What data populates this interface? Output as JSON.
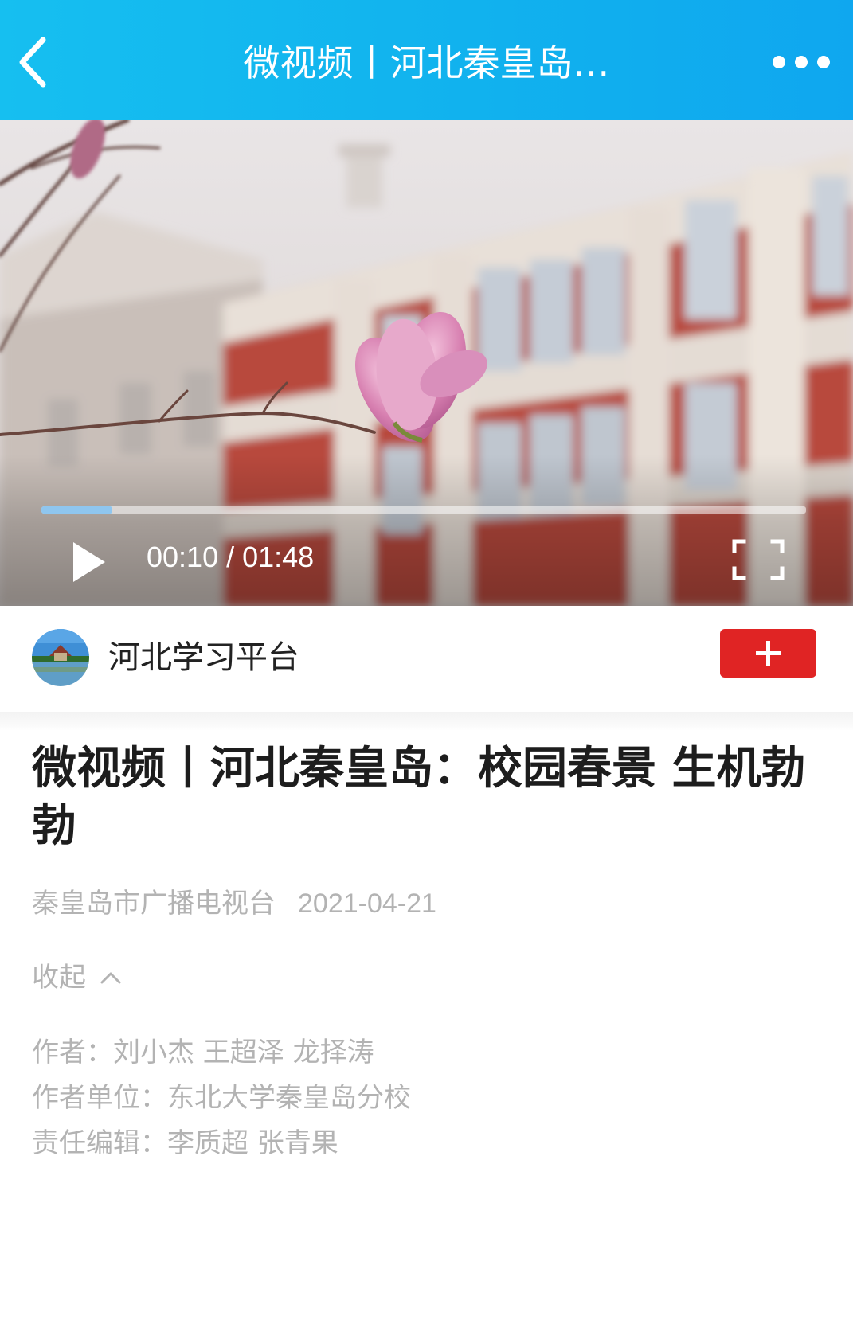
{
  "header": {
    "title": "微视频丨河北秦皇岛…",
    "back_icon": "chevron-left-icon",
    "more_icon": "more-dots-icon",
    "gradient": [
      "#16bff0",
      "#0fa7ef"
    ]
  },
  "video": {
    "elapsed": "00:10",
    "duration": "01:48",
    "time_text": "00:10 / 01:48",
    "progress": 0.093,
    "play_icon": "play-icon",
    "fullscreen_icon": "fullscreen-icon"
  },
  "channel": {
    "name": "河北学习平台",
    "follow_label": "+",
    "follow_color": "#e02424"
  },
  "article": {
    "title": "微视频丨河北秦皇岛：校园春景 生机勃勃",
    "source": "秦皇岛市广播电视台",
    "date": "2021-04-21",
    "collapse_label": "收起",
    "credits": [
      "作者：刘小杰 王超泽 龙择涛",
      "作者单位：东北大学秦皇岛分校",
      "责任编辑：李质超 张青果"
    ]
  }
}
